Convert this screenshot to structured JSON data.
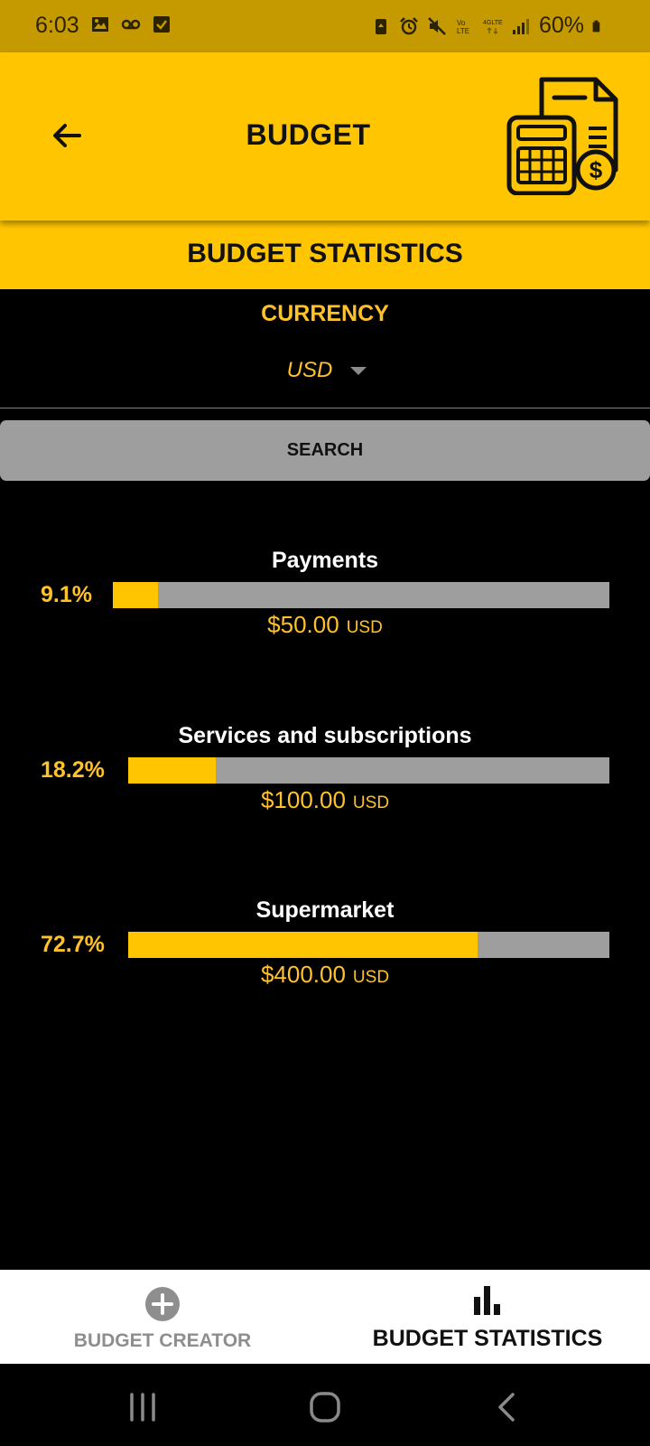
{
  "status_bar": {
    "time": "6:03",
    "battery": "60%",
    "left_icons": [
      "image-icon",
      "voicemail-icon",
      "checkbox-icon"
    ],
    "right_icons": [
      "battery-saver-icon",
      "alarm-icon",
      "mute-icon",
      "volte-icon",
      "4g-lte-icon",
      "signal-icon",
      "battery-icon"
    ]
  },
  "app_bar": {
    "title": "BUDGET",
    "back_icon": "arrow-left-icon",
    "logo_icon": "calculator-invoice-icon"
  },
  "tab_header": {
    "title": "BUDGET STATISTICS"
  },
  "currency": {
    "label": "CURRENCY",
    "selected": "USD"
  },
  "search": {
    "label": "SEARCH"
  },
  "stats": [
    {
      "name": "Payments",
      "percent_label": "9.1%",
      "percent": 9.1,
      "amount": "$50.00",
      "unit": "USD"
    },
    {
      "name": "Services and subscriptions",
      "percent_label": "18.2%",
      "percent": 18.2,
      "amount": "$100.00",
      "unit": "USD"
    },
    {
      "name": "Supermarket",
      "percent_label": "72.7%",
      "percent": 72.7,
      "amount": "$400.00",
      "unit": "USD"
    }
  ],
  "bottom_nav": {
    "creator": {
      "label": "BUDGET CREATOR",
      "icon": "plus-circle-icon",
      "active": false
    },
    "statistics": {
      "label": "BUDGET STATISTICS",
      "icon": "bar-chart-icon",
      "active": true
    }
  },
  "colors": {
    "accent": "#ffc500",
    "accent_text": "#ffc228",
    "status_bar": "#c59a00",
    "bar_track": "#9e9e9e",
    "background": "#000000"
  }
}
